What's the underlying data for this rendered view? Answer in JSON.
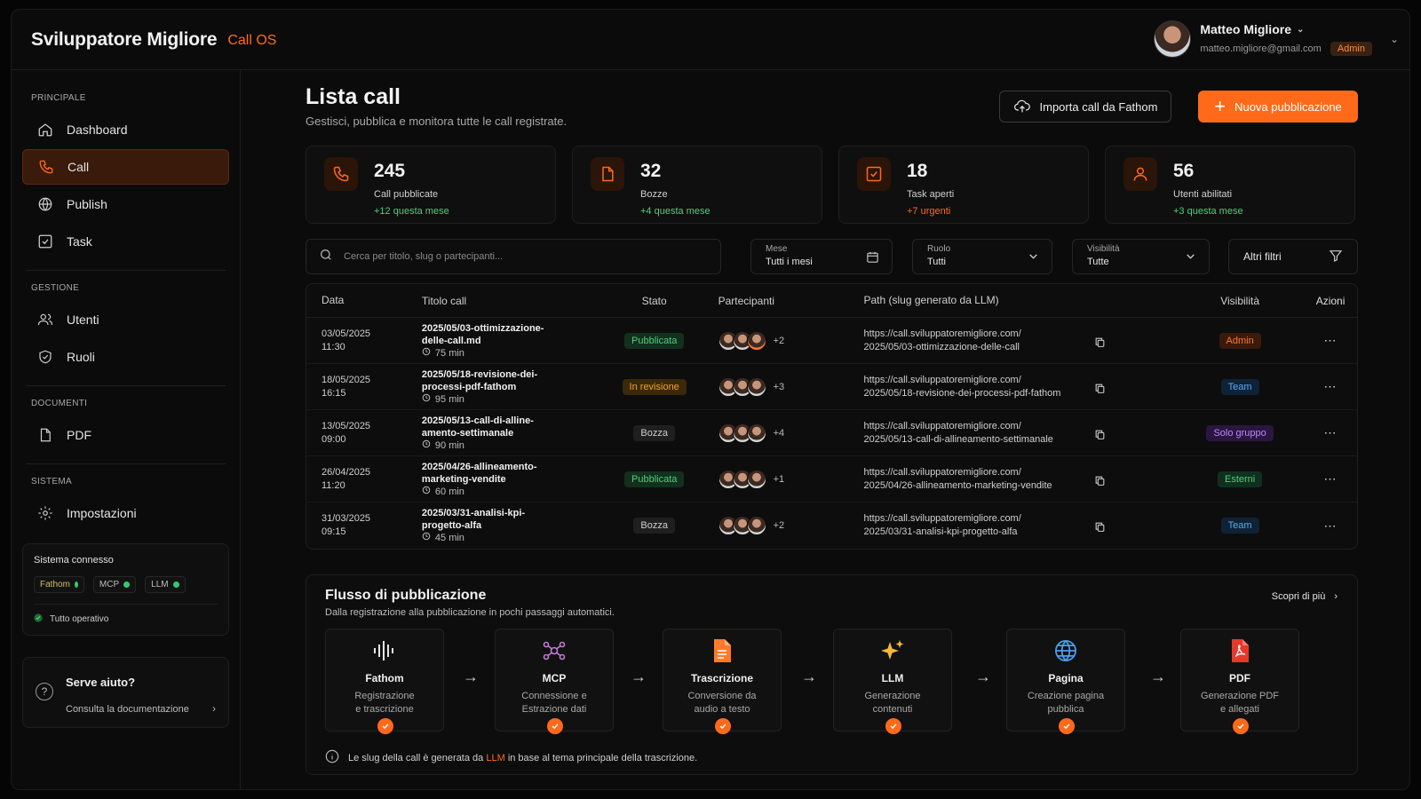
{
  "app": {
    "brand": "Sviluppatore Migliore",
    "sub": "Call OS"
  },
  "user": {
    "name": "Matteo Migliore",
    "email": "matteo.migliore@gmail.com",
    "role": "Admin"
  },
  "sidebar": {
    "sections": [
      {
        "title": "PRINCIPALE",
        "items": [
          "Dashboard",
          "Call",
          "Publish",
          "Task"
        ]
      },
      {
        "title": "GESTIONE",
        "items": [
          "Utenti",
          "Ruoli"
        ]
      },
      {
        "title": "DOCUMENTI",
        "items": [
          "PDF"
        ]
      },
      {
        "title": "SISTEMA",
        "items": [
          "Impostazioni"
        ]
      }
    ],
    "active": "Call",
    "system": {
      "title": "Sistema connesso",
      "chips": [
        "Fathom",
        "MCP",
        "LLM"
      ],
      "status": "Tutto operativo"
    },
    "help": {
      "title": "Serve aiuto?",
      "link": "Consulta la documentazione"
    }
  },
  "page": {
    "title": "Lista call",
    "subtitle": "Gestisci, pubblica e monitora tutte le call registrate.",
    "import_btn": "Importa call da Fathom",
    "new_btn": "Nuova pubblicazione"
  },
  "stats": [
    {
      "value": "245",
      "label": "Call pubblicate",
      "delta": "+12 questa mese"
    },
    {
      "value": "32",
      "label": "Bozze",
      "delta": "+4 questa mese"
    },
    {
      "value": "18",
      "label": "Task aperti",
      "delta": "+7 urgenti"
    },
    {
      "value": "56",
      "label": "Utenti abilitati",
      "delta": "+3 questa mese"
    }
  ],
  "filters": {
    "search_placeholder": "Cerca per titolo, slug o partecipanti...",
    "month": {
      "label": "Mese",
      "value": "Tutti i mesi"
    },
    "role": {
      "label": "Ruolo",
      "value": "Tutti"
    },
    "visibility": {
      "label": "Visibilità",
      "value": "Tutte"
    },
    "more": "Altri filtri"
  },
  "table": {
    "headers": [
      "Data",
      "Titolo call",
      "Stato",
      "Partecipanti",
      "Path (slug generato da LLM)",
      "Visibilità",
      "Azioni"
    ],
    "rows": [
      {
        "date": "03/05/2025",
        "time": "11:30",
        "title1": "2025/05/03-ottimizzazione-",
        "title2": "delle-call.md",
        "dur": "75 min",
        "state": "Pubblicata",
        "more": "+2",
        "path1": "https://call.sviluppatoremigliore.com/",
        "path2": "2025/05/03-ottimizzazione-delle-call",
        "vis": "Admin"
      },
      {
        "date": "18/05/2025",
        "time": "16:15",
        "title1": "2025/05/18-revisione-dei-",
        "title2": "processi-pdf-fathom",
        "dur": "95 min",
        "state": "In revisione",
        "more": "+3",
        "path1": "https://call.sviluppatoremigliore.com/",
        "path2": "2025/05/18-revisione-dei-processi-pdf-fathom",
        "vis": "Team"
      },
      {
        "date": "13/05/2025",
        "time": "09:00",
        "title1": "2025/05/13-call-di-alline-",
        "title2": "amento-settimanale",
        "dur": "90 min",
        "state": "Bozza",
        "more": "+4",
        "path1": "https://call.sviluppatoremigliore.com/",
        "path2": "2025/05/13-call-di-allineamento-settimanale",
        "vis": "Solo gruppo"
      },
      {
        "date": "26/04/2025",
        "time": "11:20",
        "title1": "2025/04/26-allineamento-",
        "title2": "marketing-vendite",
        "dur": "60 min",
        "state": "Pubblicata",
        "more": "+1",
        "path1": "https://call.sviluppatoremigliore.com/",
        "path2": "2025/04/26-allineamento-marketing-vendite",
        "vis": "Esterni"
      },
      {
        "date": "31/03/2025",
        "time": "09:15",
        "title1": "2025/03/31-analisi-kpi-",
        "title2": "progetto-alfa",
        "dur": "45 min",
        "state": "Bozza",
        "more": "+2",
        "path1": "https://call.sviluppatoremigliore.com/",
        "path2": "2025/03/31-analisi-kpi-progetto-alfa",
        "vis": "Team"
      }
    ]
  },
  "flow": {
    "title": "Flusso di pubblicazione",
    "subtitle": "Dalla registrazione alla pubblicazione in pochi passaggi automatici.",
    "more": "Scopri di più",
    "steps": [
      {
        "name": "Fathom",
        "d1": "Registrazione",
        "d2": "e trascrizione"
      },
      {
        "name": "MCP",
        "d1": "Connessione e",
        "d2": "Estrazione dati"
      },
      {
        "name": "Trascrizione",
        "d1": "Conversione da",
        "d2": "audio a testo"
      },
      {
        "name": "LLM",
        "d1": "Generazione",
        "d2": "contenuti"
      },
      {
        "name": "Pagina",
        "d1": "Creazione pagina",
        "d2": "pubblica"
      },
      {
        "name": "PDF",
        "d1": "Generazione PDF",
        "d2": "e allegati"
      }
    ],
    "note_pre": "Le slug della call è generata da",
    "note_hl": "LLM",
    "note_post": "in base al tema principale della trascrizione."
  },
  "colors": {
    "accent": "#ff6a1a",
    "bg": "#0b0b0b",
    "success": "#4cd07a"
  }
}
